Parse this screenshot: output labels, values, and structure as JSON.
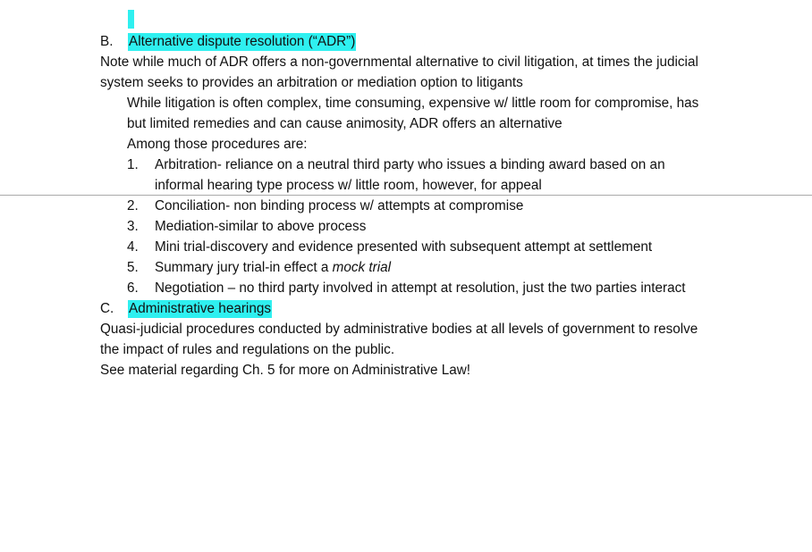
{
  "document": {
    "highlight_color": "#2ff0f0",
    "text_color": "#111111",
    "rule_color": "#a9a9a9",
    "sections": [
      {
        "marker": "B.",
        "title": "Alternative dispute resolution (“ADR”)",
        "title_highlighted": true
      },
      {
        "marker": "C.",
        "title": "Administrative hearings",
        "title_highlighted": true
      }
    ],
    "paragraphs": {
      "b_note_line1": "Note while much of ADR offers a non-governmental alternative to civil litigation, at times the judicial",
      "b_note_line2": "system seeks to provides an arbitration or mediation option to litigants",
      "b_indent_line1": "While litigation is often complex, time consuming, expensive w/ little room for compromise, has",
      "b_indent_line2": "but limited remedies and can cause animosity, ADR offers an alternative",
      "b_indent_line3": "Among those procedures are:",
      "c_line1": "Quasi-judicial procedures conducted by administrative bodies at all levels of government to resolve",
      "c_line2": "the impact of rules and regulations on the public.",
      "c_line3": "See material regarding Ch. 5 for more on Administrative Law!"
    },
    "numbered_list": [
      {
        "num": "1.",
        "text": "Arbitration- reliance on a neutral third party who issues a binding award based on an",
        "continuation": "informal hearing type process w/ little room, however, for appeal"
      },
      {
        "num": "2.",
        "text": "Conciliation- non binding process w/ attempts at compromise",
        "continuation": ""
      },
      {
        "num": "3.",
        "text": "Mediation-similar to above process",
        "continuation": ""
      },
      {
        "num": "4.",
        "text": "Mini trial-discovery and evidence presented with subsequent attempt at settlement",
        "continuation": ""
      },
      {
        "num": "5.",
        "text_before_italic": "Summary jury trial-in effect a ",
        "italic_text": "mock trial",
        "continuation": ""
      },
      {
        "num": "6.",
        "text": "Negotiation – no third party involved in attempt at resolution, just the two parties interact",
        "continuation": ""
      }
    ]
  }
}
